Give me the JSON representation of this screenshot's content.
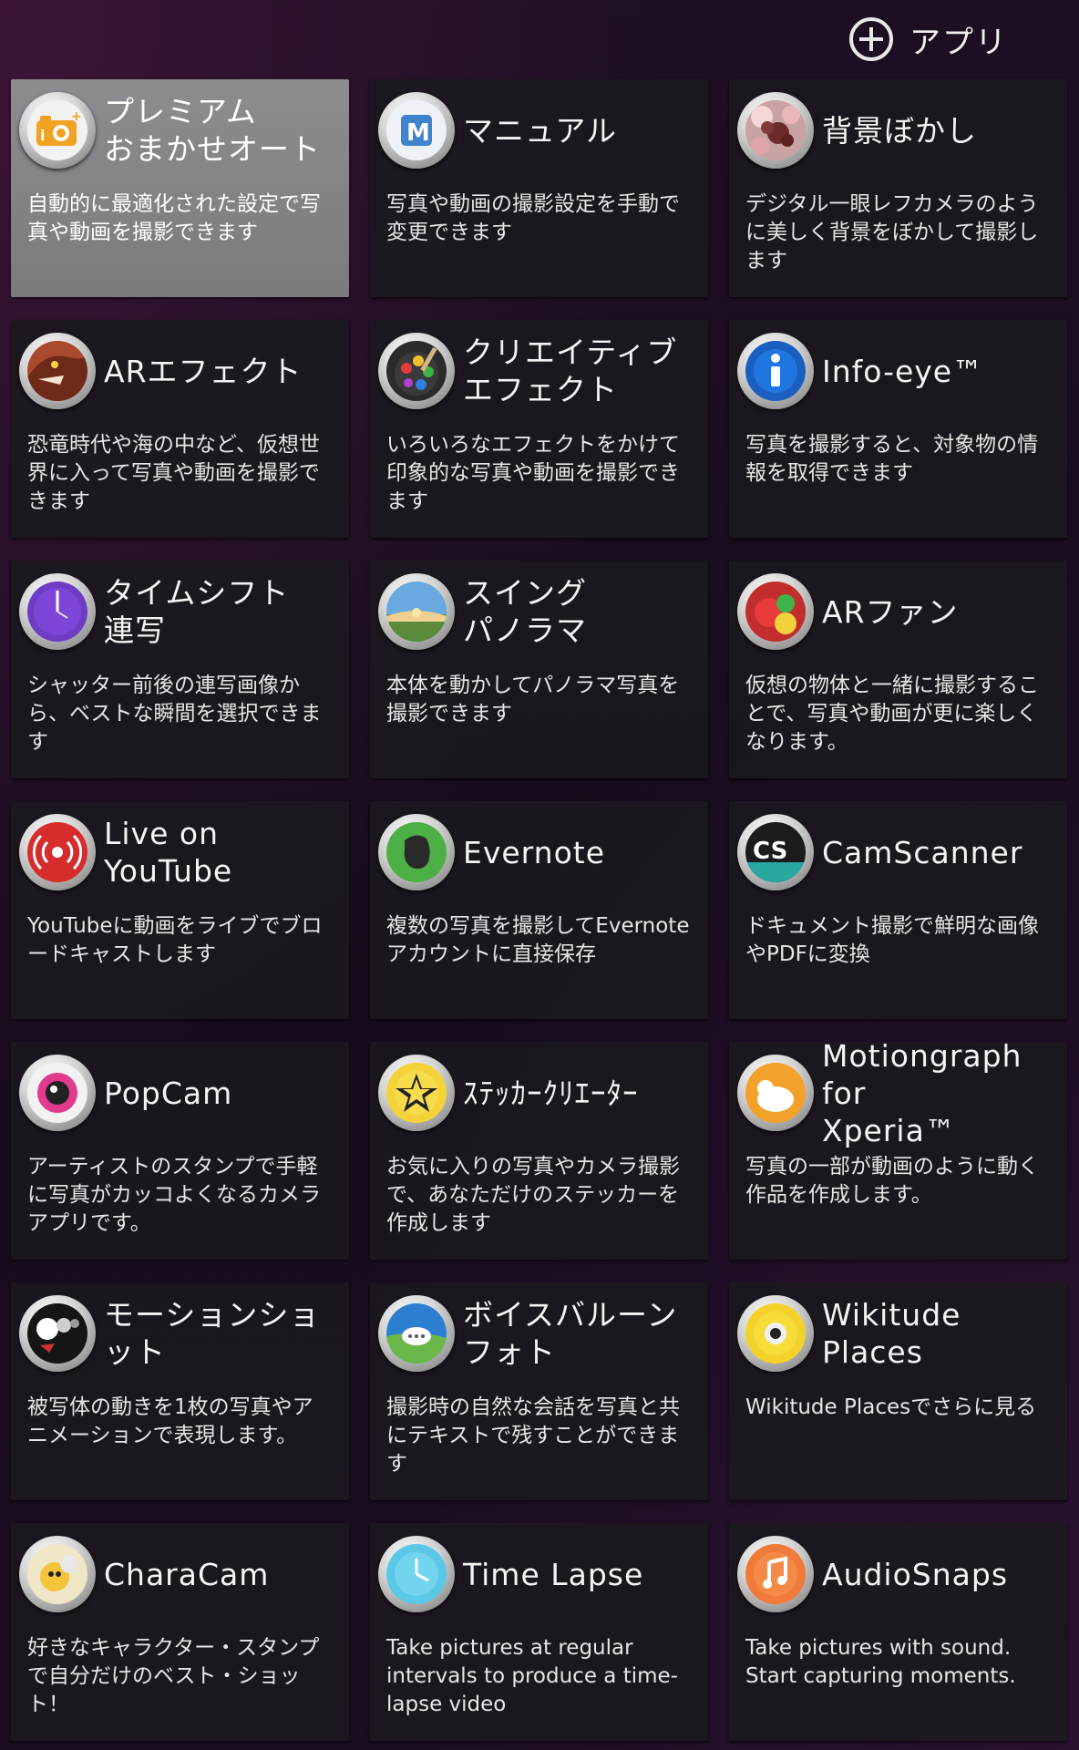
{
  "header": {
    "add_app_label": "アプリ"
  },
  "apps": [
    {
      "title": "プレミアム\nおまかせオート",
      "desc": "自動的に最適化された設定で写真や動画を撮影できます",
      "icon": "superior-auto-icon",
      "selected": true
    },
    {
      "title": "マニュアル",
      "desc": "写真や動画の撮影設定を手動で変更できます",
      "icon": "manual-icon"
    },
    {
      "title": "背景ぼかし",
      "desc": "デジタル一眼レフカメラのように美しく背景をぼかして撮影します",
      "icon": "background-defocus-icon"
    },
    {
      "title": "ARエフェクト",
      "desc": "恐竜時代や海の中など、仮想世界に入って写真や動画を撮影できます",
      "icon": "ar-effect-icon"
    },
    {
      "title": "クリエイティブ\nエフェクト",
      "desc": "いろいろなエフェクトをかけて印象的な写真や動画を撮影できます",
      "icon": "creative-effect-icon"
    },
    {
      "title": "Info-eye™",
      "desc": "写真を撮影すると、対象物の情報を取得できます",
      "icon": "info-eye-icon"
    },
    {
      "title": "タイムシフト\n連写",
      "desc": "シャッター前後の連写画像から、ベストな瞬間を選択できます",
      "icon": "timeshift-burst-icon"
    },
    {
      "title": "スイング\nパノラマ",
      "desc": "本体を動かしてパノラマ写真を撮影できます",
      "icon": "sweep-panorama-icon"
    },
    {
      "title": "ARファン",
      "desc": "仮想の物体と一緒に撮影することで、写真や動画が更に楽しくなります。",
      "icon": "ar-fun-icon"
    },
    {
      "title": "Live on YouTube",
      "desc": "YouTubeに動画をライブでブロードキャストします",
      "icon": "live-broadcast-icon"
    },
    {
      "title": "Evernote",
      "desc": "複数の写真を撮影してEvernote アカウントに直接保存",
      "icon": "evernote-icon"
    },
    {
      "title": "CamScanner",
      "desc": "ドキュメント撮影で鮮明な画像やPDFに変換",
      "icon": "camscanner-icon"
    },
    {
      "title": "PopCam",
      "desc": "アーティストのスタンプで手軽に写真がカッコよくなるカメラアプリです。",
      "icon": "popcam-icon"
    },
    {
      "title": "ｽﾃｯｶｰｸﾘｴｰﾀｰ",
      "desc": "お気に入りの写真やカメラ撮影で、あなただけのステッカーを作成します",
      "icon": "sticker-creator-icon"
    },
    {
      "title": "Motiongraph for\nXperia™",
      "desc": "写真の一部が動画のように動く作品を作成します。",
      "icon": "motiongraph-icon"
    },
    {
      "title": "モーションショット",
      "desc": "被写体の動きを1枚の写真やアニメーションで表現します。",
      "icon": "motion-shot-icon"
    },
    {
      "title": "ボイスバルーン\nフォト",
      "desc": "撮影時の自然な会話を写真と共にテキストで残すことができます",
      "icon": "voice-balloon-icon"
    },
    {
      "title": "Wikitude Places",
      "desc": "Wikitude Placesでさらに見る",
      "icon": "wikitude-icon"
    },
    {
      "title": "CharaCam",
      "desc": "好きなキャラクター・スタンプで自分だけのベスト・ショット！",
      "icon": "characam-icon"
    },
    {
      "title": "Time Lapse",
      "desc": "Take pictures at regular intervals to produce a time-lapse video",
      "icon": "time-lapse-icon"
    },
    {
      "title": "AudioSnaps",
      "desc": "Take pictures with sound. Start capturing moments.",
      "icon": "audiosnaps-icon"
    }
  ]
}
